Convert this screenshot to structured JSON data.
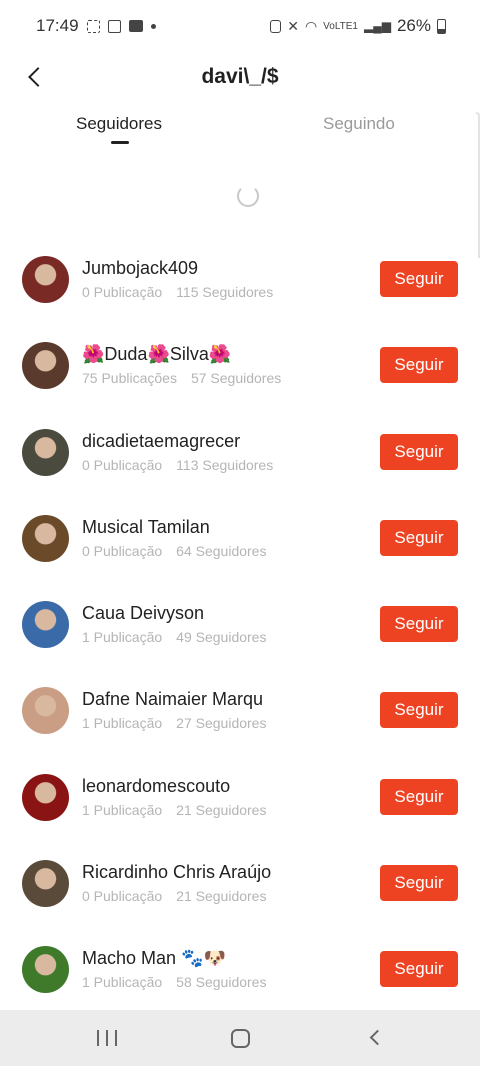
{
  "status": {
    "time": "17:49",
    "network": "VoLTE1",
    "battery": "26%"
  },
  "header": {
    "title": "davi\\_/$",
    "back_icon": "chevron-left-icon"
  },
  "tabs": {
    "followers": "Seguidores",
    "following": "Seguindo",
    "active": "followers"
  },
  "follow_label": "Seguir",
  "accent_color": "#ee4323",
  "users": [
    {
      "name": "Jumbojack409",
      "posts": "0 Publicação",
      "followers": "115 Seguidores",
      "avatar_color": "#7a2a24"
    },
    {
      "name": "🌺Duda🌺Silva🌺",
      "posts": "75 Publicações",
      "followers": "57 Seguidores",
      "avatar_color": "#5a3a2c"
    },
    {
      "name": "dicadietaemagrecer",
      "posts": "0 Publicação",
      "followers": "113 Seguidores",
      "avatar_color": "#4a4a3e"
    },
    {
      "name": "Musical Tamilan",
      "posts": "0 Publicação",
      "followers": "64 Seguidores",
      "avatar_color": "#6b4a2a"
    },
    {
      "name": "Caua Deivyson",
      "posts": "1 Publicação",
      "followers": "49 Seguidores",
      "avatar_color": "#3a6aa8"
    },
    {
      "name": "Dafne Naimaier Marqu",
      "posts": "1 Publicação",
      "followers": "27 Seguidores",
      "avatar_color": "#c99e84"
    },
    {
      "name": "leonardomescouto",
      "posts": "1 Publicação",
      "followers": "21 Seguidores",
      "avatar_color": "#8a1414"
    },
    {
      "name": "Ricardinho Chris Araújo",
      "posts": "0 Publicação",
      "followers": "21 Seguidores",
      "avatar_color": "#5a4a3a"
    },
    {
      "name": "Macho Man 🐾🐶",
      "posts": "1 Publicação",
      "followers": "58 Seguidores",
      "avatar_color": "#3e7a2a"
    }
  ]
}
